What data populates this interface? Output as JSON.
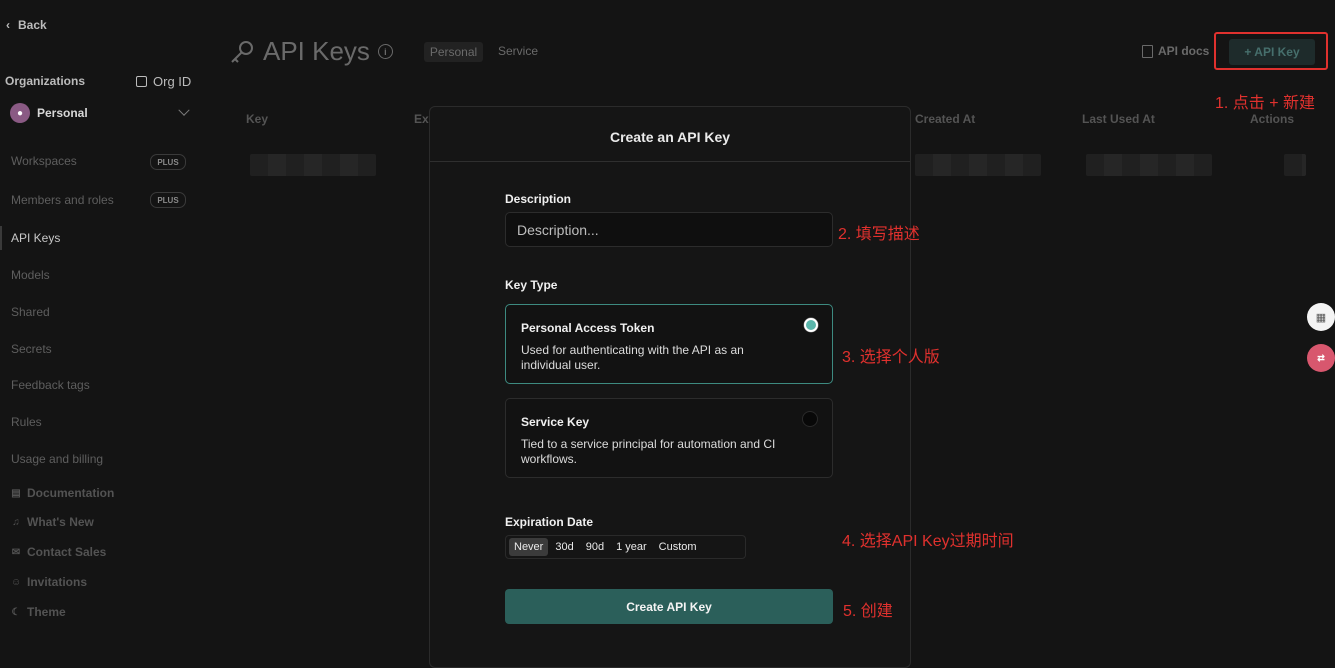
{
  "sidebar": {
    "back": "Back",
    "organizations_label": "Organizations",
    "org_id_label": "Org ID",
    "org_name": "Personal",
    "nav": [
      {
        "label": "Workspaces",
        "badge": "PLUS"
      },
      {
        "label": "Members and roles",
        "badge": "PLUS"
      },
      {
        "label": "API Keys"
      },
      {
        "label": "Models"
      },
      {
        "label": "Shared"
      },
      {
        "label": "Secrets"
      },
      {
        "label": "Feedback tags"
      },
      {
        "label": "Rules"
      },
      {
        "label": "Usage and billing"
      }
    ],
    "footer": [
      {
        "label": "Documentation",
        "icon": "document-icon"
      },
      {
        "label": "What's New",
        "icon": "bell-icon"
      },
      {
        "label": "Contact Sales",
        "icon": "mail-icon"
      },
      {
        "label": "Invitations",
        "icon": "user-icon"
      },
      {
        "label": "Theme",
        "icon": "moon-icon"
      }
    ]
  },
  "header": {
    "title": "API Keys",
    "tabs": [
      "Personal",
      "Service"
    ],
    "api_docs": "API docs",
    "add_key": "+ API Key"
  },
  "table": {
    "columns": [
      "Key",
      "Ex",
      "Created At",
      "Last Used At",
      "Actions"
    ]
  },
  "modal": {
    "title": "Create an API Key",
    "description_label": "Description",
    "description_placeholder": "Description...",
    "key_type_label": "Key Type",
    "key_types": [
      {
        "title": "Personal Access Token",
        "desc": "Used for authenticating with the API as an individual user.",
        "selected": true
      },
      {
        "title": "Service Key",
        "desc": "Tied to a service principal for automation and CI workflows.",
        "selected": false
      }
    ],
    "expiration_label": "Expiration Date",
    "expiration_options": [
      "Never",
      "30d",
      "90d",
      "1 year",
      "Custom"
    ],
    "expiration_selected": "Never",
    "submit": "Create API Key"
  },
  "annotations": [
    "1. 点击 + 新建",
    "2. 填写描述",
    "3. 选择个人版",
    "4. 选择API Key过期时间",
    "5. 创建"
  ],
  "colors": {
    "background": "#141414",
    "accent": "#2b5f5a",
    "selected_border": "#3d8a80",
    "annotation": "#e0312e"
  }
}
